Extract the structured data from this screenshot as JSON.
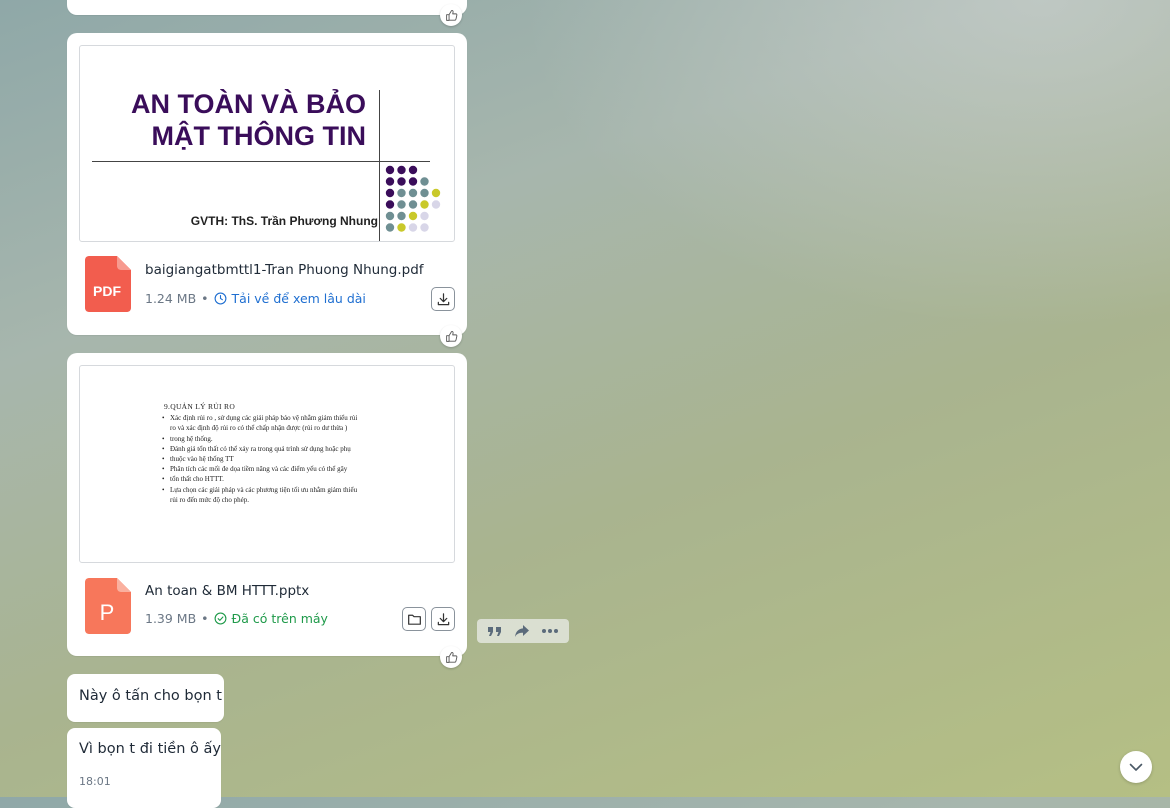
{
  "messages": {
    "file1": {
      "preview": {
        "title_line1": "AN TOÀN VÀ BẢO",
        "title_line2": "MẬT THÔNG TIN",
        "subtitle": "GVTH:  ThS. Trần Phương Nhung"
      },
      "icon_label": "PDF",
      "name": "baigiangatbmttl1-Tran Phuong  Nhung.pdf",
      "size": "1.24 MB",
      "separator": "•",
      "status": "Tải về để xem lâu dài",
      "status_icon": "clock-icon",
      "accent": "#1f6fd1"
    },
    "file2": {
      "preview": {
        "title": "9.QUẢN LÝ  RỦI  RO",
        "lines": [
          "Xác định rủi ro , sử dụng các giải pháp bảo vệ nhằm giảm thiểu rủi",
          "ro và xác định độ rủi ro có thể chấp nhận được (rủi ro dư thừa )",
          "trong hệ thống.",
          "Đánh giá tổn thất có thể xảy ra trong quá trình sử dụng hoặc phụ",
          "thuộc vào hệ thống TT",
          "Phân tích các mối đe dọa tiềm năng và các điểm yếu có thể gây",
          "tổn thất cho HTTT.",
          "Lựa chọn các giải pháp  và các phương tiện tối ưu nhằm giảm thiểu",
          "rủi ro đến mức độ cho phép."
        ]
      },
      "icon_label": "P",
      "name": "An toan & BM HTTT.pptx",
      "size": "1.39 MB",
      "separator": "•",
      "status": "Đã có trên máy",
      "status_icon": "check-circle-icon",
      "accent": "#1f9a4a"
    },
    "text1": {
      "text": "Này ô tấn cho bọn t"
    },
    "text2": {
      "text": "Vì bọn t đi tiền ô ấy",
      "time": "18:01"
    }
  },
  "colors": {
    "pdf": "#f25d4e",
    "pptx": "#f7775b",
    "slide_title": "#3a0d5a"
  },
  "hover_actions": [
    "quote-icon",
    "forward-icon",
    "more-icon"
  ]
}
